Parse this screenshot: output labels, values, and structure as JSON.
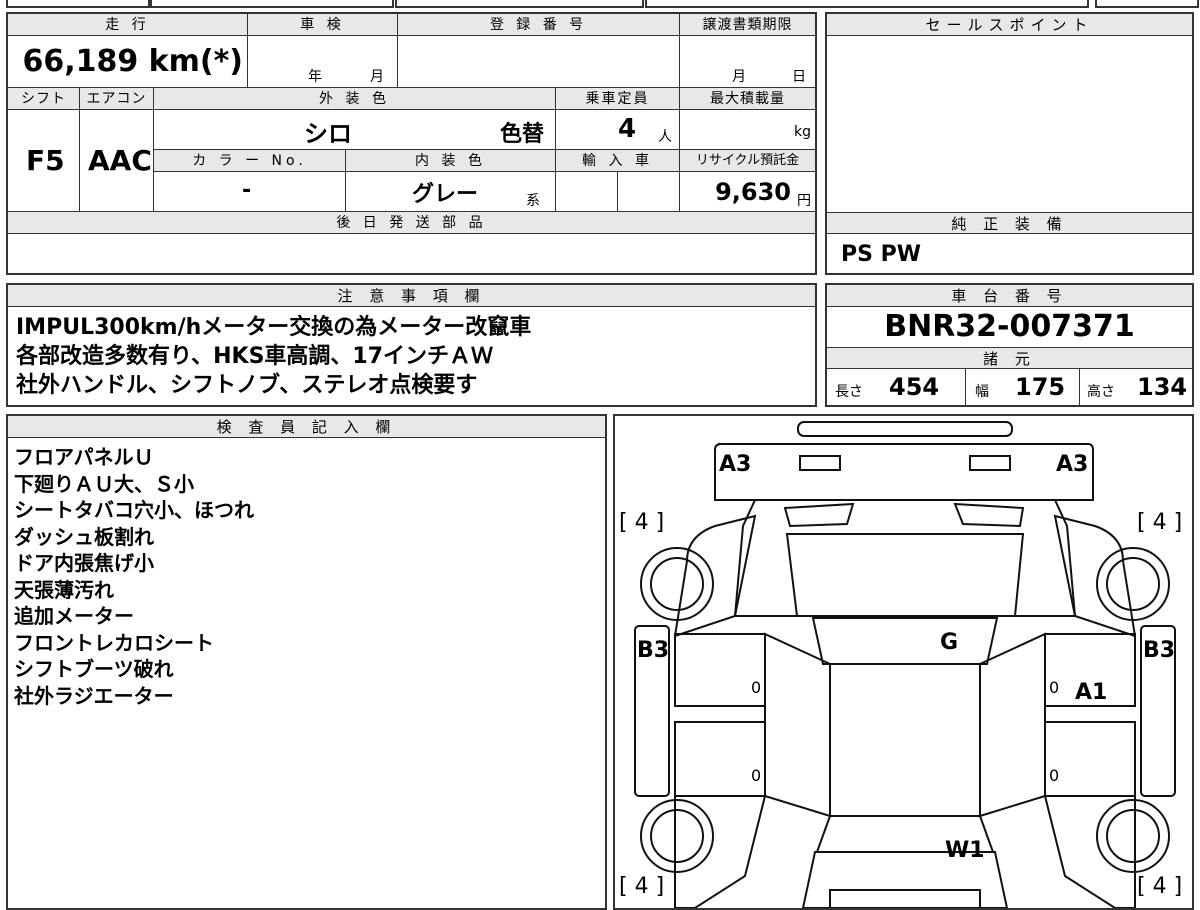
{
  "top_summary": {
    "mileage_label": "走 行",
    "mileage_value": "66,189 km(*)",
    "inspection_label": "車 検",
    "inspection_year": "年",
    "inspection_month": "月",
    "registration_label": "登 録 番 号",
    "registration_value": "",
    "transfer_label": "譲渡書類期限",
    "transfer_month": "月",
    "transfer_day": "日"
  },
  "specs": {
    "shift_label": "シフト",
    "shift_value": "F5",
    "ac_label": "エアコン",
    "ac_value": "AAC",
    "exterior_label": "外 装 色",
    "exterior_value": "シロ",
    "repaint": "色替",
    "capacity_label": "乗車定員",
    "capacity_value": "4",
    "capacity_unit": "人",
    "maxload_label": "最大積載量",
    "maxload_unit": "kg",
    "color_no_label": "カ ラ ー No.",
    "color_no_value": "-",
    "interior_label": "内 装 色",
    "interior_value": "グレー",
    "interior_suffix": "系",
    "import_label": "輸 入 車",
    "recycle_label": "リサイクル預託金",
    "recycle_value": "9,630",
    "recycle_unit": "円"
  },
  "later_parts": {
    "label": "後 日 発 送 部 品",
    "value": ""
  },
  "sales_point": {
    "label": "セールスポイント",
    "value": ""
  },
  "genuine_equipment": {
    "label": "純 正 装 備",
    "value": "PS PW"
  },
  "notes": {
    "label": "注 意 事 項 欄",
    "lines": [
      "IMPUL300km/hメーター交換の為メーター改竄車",
      "各部改造多数有り、HKS車高調、17インチＡＷ",
      "社外ハンドル、シフトノブ、ステレオ点検要す"
    ]
  },
  "chassis": {
    "label": "車 台 番 号",
    "value": "BNR32-007371"
  },
  "dimensions": {
    "label": "諸 元",
    "length_label": "長さ",
    "length_value": "454",
    "width_label": "幅",
    "width_value": "175",
    "height_label": "高さ",
    "height_value": "134"
  },
  "inspector": {
    "label": "検 査 員 記 入 欄",
    "lines": [
      "フロアパネルＵ",
      "下廻りＡＵ大、Ｓ小",
      "シートタバコ穴小、ほつれ",
      "ダッシュ板割れ",
      "ドア内張焦げ小",
      "天張薄汚れ",
      "追加メーター",
      "フロントレカロシート",
      "シフトブーツ破れ",
      "社外ラジエーター"
    ]
  },
  "diagram": {
    "marks": {
      "front_left": "A3",
      "front_right": "A3",
      "tire_fl": "[ 4 ]",
      "tire_fr": "[ 4 ]",
      "tire_rl": "[ 4 ]",
      "tire_rr": "[ 4 ]",
      "side_left": "B3",
      "side_right": "B3",
      "glass": "G",
      "door_right": "A1",
      "rear_window": "W1",
      "door_fl_zero": "0",
      "door_rl_zero": "0",
      "door_fr_zero": "0",
      "door_rr_zero": "0"
    }
  }
}
